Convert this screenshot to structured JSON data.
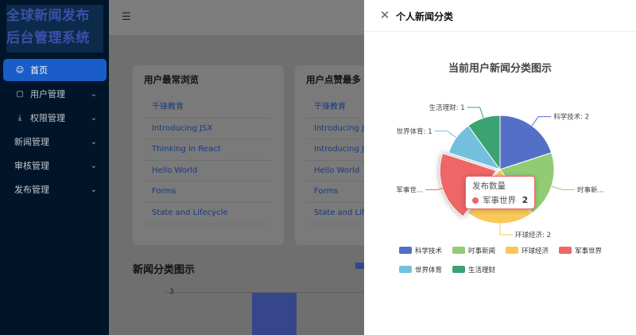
{
  "sidebar": {
    "logo_line1": "全球新闻发布",
    "logo_line2": "后台管理系统",
    "items": [
      {
        "label": "首页",
        "icon": "user-icon",
        "active": true
      },
      {
        "label": "用户管理",
        "icon": "video-icon"
      },
      {
        "label": "权限管理",
        "icon": "download-icon"
      },
      {
        "label": "新闻管理"
      },
      {
        "label": "审核管理"
      },
      {
        "label": "发布管理"
      }
    ]
  },
  "topbar": {
    "fold_icon": "menu-fold-icon"
  },
  "cards": [
    {
      "title": "用户最常浏览",
      "items": [
        "千锋教育",
        "Introducing JSX",
        "Thinking in React",
        "Hello World",
        "Forms",
        "State and Lifecycle"
      ]
    },
    {
      "title": "用户点赞最多",
      "items": [
        "千锋教育",
        "Introducing JSX",
        "Introducing JSX",
        "Hello World",
        "Forms",
        "State and Lifecycle"
      ]
    }
  ],
  "news_chart": {
    "title": "新闻分类图示",
    "tick": "3"
  },
  "drawer": {
    "title": "个人新闻分类",
    "close_icon": "close-icon"
  },
  "chart_data": {
    "type": "pie",
    "title": "当前用户新闻分类图示",
    "series_name": "发布数量",
    "slices": [
      {
        "name": "科学技术",
        "value": 2,
        "color": "#5470c6",
        "label": "科学技术: 2"
      },
      {
        "name": "时事新闻",
        "value": 2,
        "color": "#91cc75",
        "label": "时事新..."
      },
      {
        "name": "环球经济",
        "value": 2,
        "color": "#fac858",
        "label": "环球经济: 2"
      },
      {
        "name": "军事世界",
        "value": 2,
        "color": "#ee6666",
        "label": "军事世..."
      },
      {
        "name": "世界体育",
        "value": 1,
        "color": "#73c0de",
        "label": "世界体育: 1"
      },
      {
        "name": "生活理财",
        "value": 1,
        "color": "#3ba272",
        "label": "生活理财: 1"
      }
    ],
    "legend": [
      "科学技术",
      "时事新闻",
      "环球经济",
      "军事世界",
      "世界体育",
      "生活理财"
    ],
    "highlighted": "军事世界",
    "legend_position": "bottom"
  },
  "tooltip": {
    "title": "发布数量",
    "name": "军事世界",
    "value": "2"
  }
}
